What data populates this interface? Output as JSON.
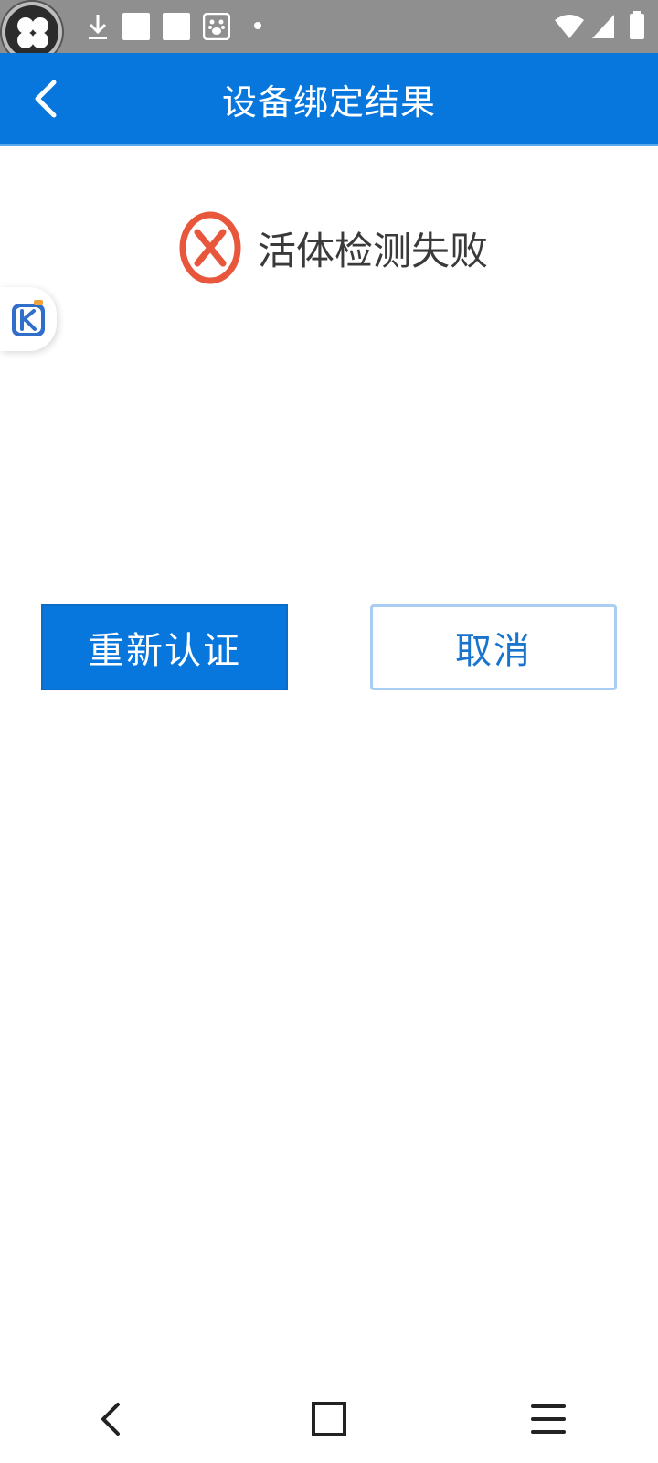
{
  "header": {
    "title": "设备绑定结果"
  },
  "result": {
    "message": "活体检测失败",
    "status_color": "#e8573c"
  },
  "actions": {
    "retry_label": "重新认证",
    "cancel_label": "取消"
  },
  "colors": {
    "primary": "#0877dd",
    "status_bar": "#8f8f8f"
  },
  "icons": {
    "back": "chevron-left-icon",
    "error": "error-circle-x-icon",
    "nav_back": "nav-back-icon",
    "nav_home": "nav-home-icon",
    "nav_menu": "nav-menu-icon"
  }
}
